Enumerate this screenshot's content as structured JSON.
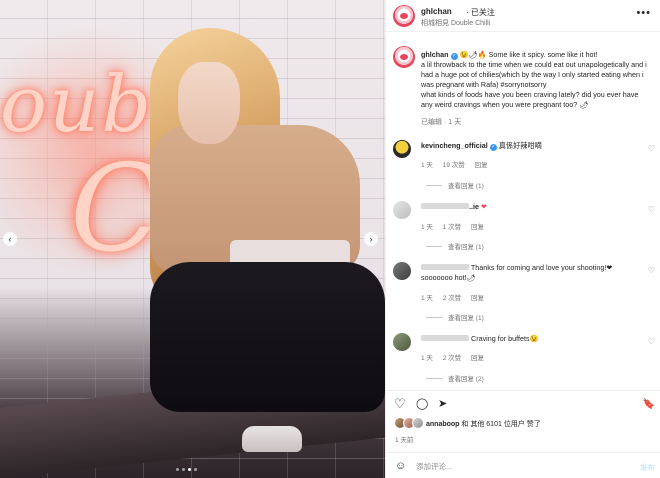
{
  "photo": {
    "neon_text": "oub",
    "neon_letter": "C",
    "prev_arrow": "‹",
    "next_arrow": "›",
    "dots_count": 4,
    "active_dot": 3
  },
  "header": {
    "username": "ghlchan",
    "follow_status": "· 已关注",
    "location": "相城相見 Double Chilli",
    "more": "•••"
  },
  "caption": {
    "username": "ghlchan",
    "text": "😉🌶🔥 Some like it spicy. some like it hot!\na lil throwback to the time when we could eat out unapologetically and i had a huge pot of chilies(which by the way I only started eating when i was pregnant with Rafa) #sorrynotsorry\nwhat kinds of foods have you been craving lately? did you ever have any weird cravings when you were pregnant too? 🌶",
    "edited": "已编辑",
    "time": "1 天"
  },
  "comments": [
    {
      "username": "kevincheng_official",
      "verified": true,
      "text": "真係好辣咁嘀",
      "time": "1 天",
      "likes": "19 次赞",
      "reply": "回复",
      "replies": "查看回复 (1)"
    },
    {
      "username_suffix": "..ie",
      "text": "❤",
      "time": "1 天",
      "likes": "1 次赞",
      "reply": "回复",
      "replies": "查看回复 (1)"
    },
    {
      "text": "Thanks for coming and love your shooting!❤ sooooooo hot!🌶",
      "time": "1 天",
      "likes": "2 次赞",
      "reply": "回复",
      "replies": "查看回复 (1)"
    },
    {
      "text": "Craving for buffets😉",
      "time": "1 天",
      "likes": "2 次赞",
      "reply": "回复",
      "replies": "查看回复 (2)"
    }
  ],
  "actions": {
    "like": "♡",
    "comment": "◯",
    "share": "➤",
    "save": "🔖"
  },
  "likes": {
    "liker": "annaboop",
    "rest": " 和 其他 6101 位用户 赞了"
  },
  "post_time": "1 天前",
  "composer": {
    "emoji": "☺",
    "placeholder": "添加评论...",
    "post": "发布"
  },
  "colors": {
    "verified": "#3897f0",
    "muted": "#737373",
    "post_button": "#b2dffc",
    "heart": "#ed4956"
  }
}
